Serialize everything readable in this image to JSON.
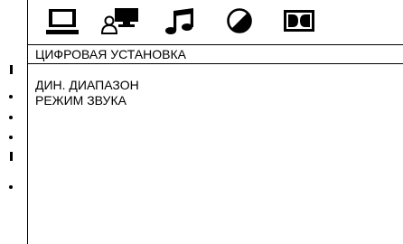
{
  "header": {
    "tabs": [
      {
        "icon": "tv-monitor-icon"
      },
      {
        "icon": "user-display-icon"
      },
      {
        "icon": "music-note-icon"
      },
      {
        "icon": "color-disc-icon"
      },
      {
        "icon": "dolby-icon"
      }
    ]
  },
  "panel": {
    "title": "ЦИФРОВАЯ УСТАНОВКА"
  },
  "menu": {
    "items": [
      {
        "label": "ДИН. ДИАПАЗОН"
      },
      {
        "label": "РЕЖИМ ЗВУКА"
      }
    ]
  }
}
